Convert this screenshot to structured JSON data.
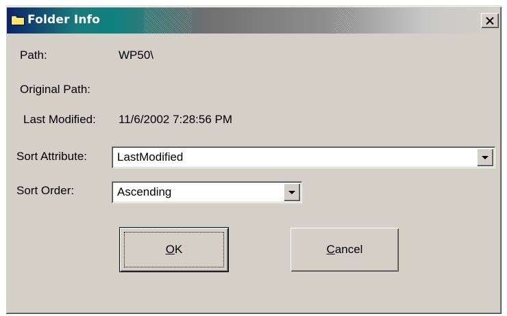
{
  "window": {
    "title": "Folder Info",
    "title_icon": "folder-icon",
    "close_icon": "close-icon"
  },
  "info": {
    "path_label": "Path:",
    "path_value": "WP50\\",
    "original_path_label": "Original Path:",
    "original_path_value": "",
    "last_modified_label": "Last Modified:",
    "last_modified_value": "11/6/2002 7:28:56 PM"
  },
  "sort": {
    "attribute_label": "Sort Attribute:",
    "attribute_value": "LastModified",
    "order_label": "Sort Order:",
    "order_value": "Ascending"
  },
  "buttons": {
    "ok_mnemonic": "O",
    "ok_rest": "K",
    "cancel_mnemonic": "C",
    "cancel_rest": "ancel"
  },
  "colors": {
    "face": "#d4d0c8",
    "title_start": "#0a246a",
    "title_text": "#ffffff"
  }
}
